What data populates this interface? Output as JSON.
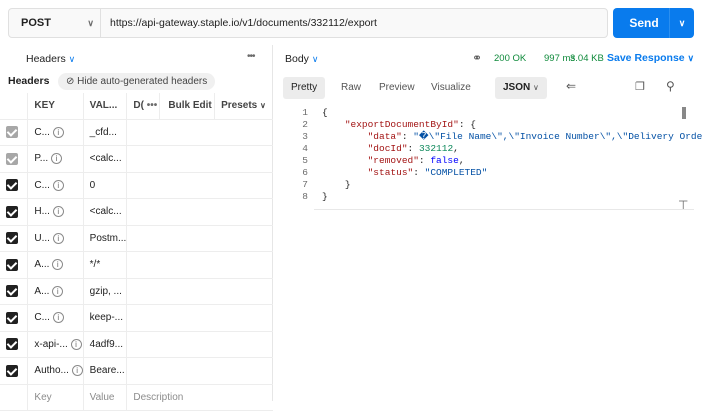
{
  "request": {
    "method": "POST",
    "url": "https://api-gateway.staple.io/v1/documents/332112/export",
    "send_label": "Send"
  },
  "left_panel": {
    "title": "Headers",
    "subtitle": "Headers",
    "hide_label": "Hide auto-generated headers",
    "columns": {
      "key": "KEY",
      "value": "VAL...",
      "desc": "D(",
      "bulk": "Bulk Edit",
      "presets": "Presets"
    },
    "rows": [
      {
        "checkbox": "grey",
        "key": "C...",
        "value": "_cfd..."
      },
      {
        "checkbox": "grey",
        "key": "P...",
        "value": "<calc..."
      },
      {
        "checkbox": "dark",
        "key": "C...",
        "value": "0"
      },
      {
        "checkbox": "dark",
        "key": "H...",
        "value": "<calc..."
      },
      {
        "checkbox": "dark",
        "key": "U...",
        "value": "Postm..."
      },
      {
        "checkbox": "dark",
        "key": "A...",
        "value": "*/*"
      },
      {
        "checkbox": "dark",
        "key": "A...",
        "value": "gzip, ..."
      },
      {
        "checkbox": "dark",
        "key": "C...",
        "value": "keep-..."
      },
      {
        "checkbox": "dark",
        "key": "x-api-...",
        "value": "4adf9..."
      },
      {
        "checkbox": "dark",
        "key": "Autho...",
        "value": "Beare..."
      }
    ],
    "placeholder": {
      "key": "Key",
      "value": "Value",
      "desc": "Description"
    }
  },
  "response": {
    "body_label": "Body",
    "status": "200 OK",
    "time": "997 ms",
    "size": "3.04 KB",
    "save_label": "Save Response",
    "tabs": [
      "Pretty",
      "Raw",
      "Preview",
      "Visualize"
    ],
    "active_tab": "Pretty",
    "format": "JSON",
    "code": {
      "line_numbers": [
        "1",
        "2",
        "3",
        "4",
        "5",
        "6",
        "7",
        "8"
      ],
      "open_brace": "{",
      "key_export": "\"exportDocumentById\"",
      "key_data": "\"data\"",
      "val_data": "\"�\\\"File Name\\\",\\\"Invoice Number\\\",\\\"Delivery Order N",
      "key_docid": "\"docId\"",
      "val_docid": "332112",
      "key_removed": "\"removed\"",
      "val_removed": "false",
      "key_status": "\"status\"",
      "val_status": "\"COMPLETED\"",
      "close_inner": "}",
      "close_outer": "}"
    }
  }
}
